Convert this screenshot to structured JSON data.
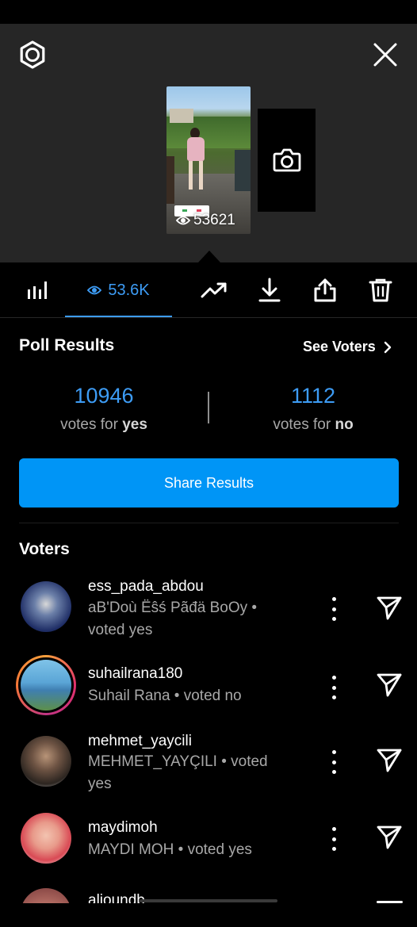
{
  "story": {
    "view_count": "53621"
  },
  "tabs": {
    "views_label": "53.6K"
  },
  "poll": {
    "title": "Poll Results",
    "see_voters": "See Voters",
    "yes_count": "10946",
    "no_count": "1112",
    "votes_for": "votes for",
    "yes_word": "yes",
    "no_word": "no",
    "share_label": "Share Results"
  },
  "voters": {
    "title": "Voters",
    "items": [
      {
        "username": "ess_pada_abdou",
        "info": "aB'Doù Ëŝś Pãđä BoOy • voted yes"
      },
      {
        "username": "suhailrana180",
        "info": "Suhail Rana • voted no"
      },
      {
        "username": "mehmet_yaycili",
        "info": "MEHMET_YAYÇILI • voted yes"
      },
      {
        "username": "maydimoh",
        "info": "MAYDI MOH • voted yes"
      },
      {
        "username": "alioundb",
        "info": ""
      }
    ]
  },
  "colors": {
    "accent": "#3d9cf5",
    "button": "#0095f6",
    "background": "#000000",
    "top_panel": "#262626"
  }
}
